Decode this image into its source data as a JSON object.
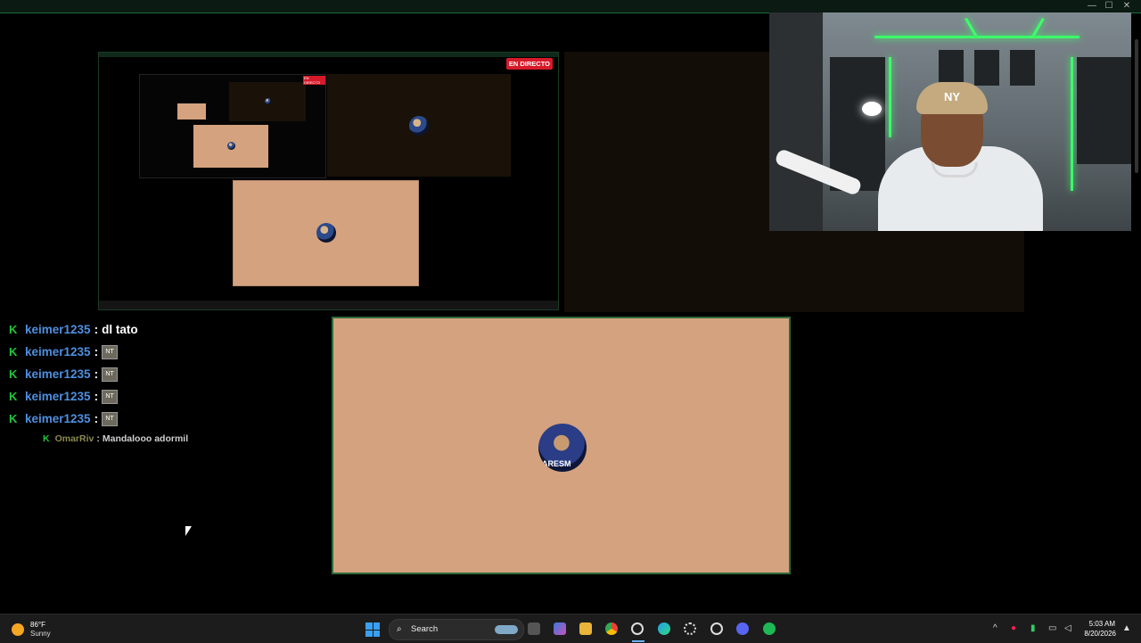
{
  "window": {
    "minimize_glyph": "—",
    "maximize_glyph": "☐",
    "close_glyph": "✕"
  },
  "live_preview": {
    "badge": "EN DIRECTO",
    "nested_badge": "EN DIRECTO"
  },
  "webcam": {
    "cap_logo": "NY"
  },
  "chat": {
    "messages": [
      {
        "user": "keimer1235",
        "text": "dl tato",
        "emote": ""
      },
      {
        "user": "keimer1235",
        "text": "",
        "emote": "NT"
      },
      {
        "user": "keimer1235",
        "text": "",
        "emote": "NT"
      },
      {
        "user": "keimer1235",
        "text": "",
        "emote": "NT"
      },
      {
        "user": "keimer1235",
        "text": "",
        "emote": "NT"
      }
    ],
    "small_message": {
      "user": "OmarRiv",
      "text": "Mandalooo adormil"
    },
    "badge_glyph": "K",
    "separator": ":"
  },
  "main_card": {
    "avatar_text": "ARESM"
  },
  "taskbar": {
    "weather_temp": "86°F",
    "weather_desc": "Sunny",
    "search_placeholder": "Search",
    "time": "5:03 AM",
    "date": "8/20/2026",
    "colors": {
      "accent": "#3aa0f2",
      "chat_badge": "#1fc93b",
      "chat_user": "#4f8fe0",
      "live": "#d61a2a"
    }
  }
}
